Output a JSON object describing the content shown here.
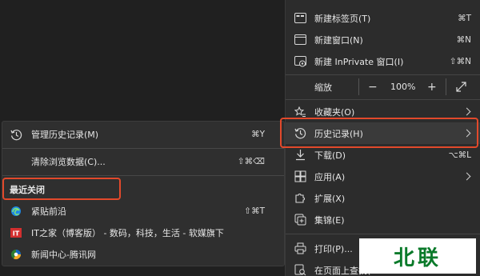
{
  "main_menu": {
    "new_tab": {
      "label": "新建标签页(T)",
      "shortcut": "⌘T"
    },
    "new_window": {
      "label": "新建窗口(N)",
      "shortcut": "⌘N"
    },
    "new_private": {
      "label": "新建 InPrivate 窗口(I)",
      "shortcut": "⇧⌘N"
    },
    "zoom": {
      "label": "缩放",
      "minus": "−",
      "value": "100%",
      "plus": "+"
    },
    "favorites": {
      "label": "收藏夹(O)"
    },
    "history": {
      "label": "历史记录(H)"
    },
    "downloads": {
      "label": "下载(D)",
      "shortcut": "⌥⌘L"
    },
    "apps": {
      "label": "应用(A)"
    },
    "extensions": {
      "label": "扩展(X)"
    },
    "collections": {
      "label": "集锦(E)"
    },
    "print": {
      "label": "打印(P)..."
    },
    "find": {
      "label": "在页面上查找("
    }
  },
  "history_menu": {
    "manage": {
      "label": "管理历史记录(M)",
      "shortcut": "⌘Y"
    },
    "clear": {
      "label": "清除浏览数据(C)...",
      "shortcut": "⇧⌘⌫"
    },
    "recent_header": "最近关闭",
    "items": [
      {
        "label": "紧贴前沿",
        "shortcut": "⇧⌘T"
      },
      {
        "label": "IT之家（博客版） - 数码，科技，生活 - 软媒旗下"
      },
      {
        "label": "新闻中心-腾讯网"
      }
    ]
  },
  "watermark": "北联",
  "colors": {
    "highlight": "#e2492b",
    "menu_bg": "#2c2c2c",
    "submenu_bg": "#2f2f2f",
    "page_bg": "#202020"
  }
}
